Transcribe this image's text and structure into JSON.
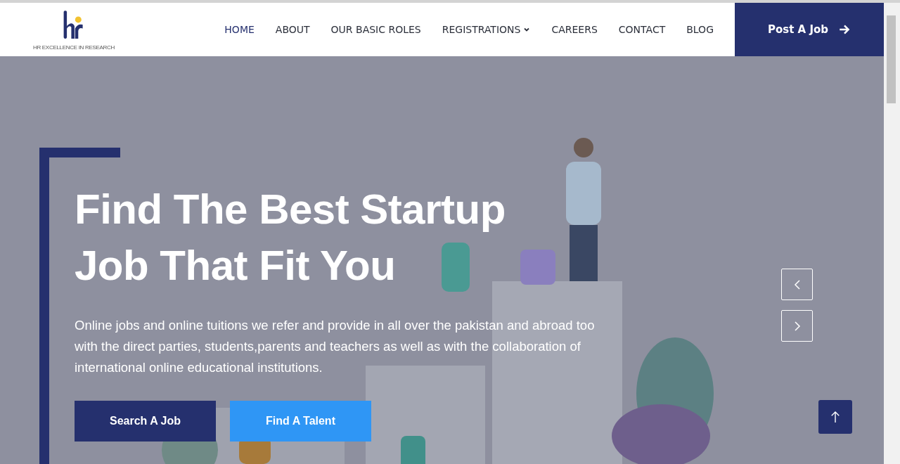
{
  "logo": {
    "caption": "HR EXCELLENCE IN RESEARCH"
  },
  "nav": [
    {
      "label": "HOME",
      "selected": true,
      "dropdown": false
    },
    {
      "label": "ABOUT",
      "selected": false,
      "dropdown": false
    },
    {
      "label": "OUR BASIC ROLES",
      "selected": false,
      "dropdown": false
    },
    {
      "label": "REGISTRATIONS",
      "selected": false,
      "dropdown": true
    },
    {
      "label": "CAREERS",
      "selected": false,
      "dropdown": false
    },
    {
      "label": "CONTACT",
      "selected": false,
      "dropdown": false
    },
    {
      "label": "BLOG",
      "selected": false,
      "dropdown": false
    }
  ],
  "cta": {
    "label": "Post A Job"
  },
  "hero": {
    "title_lines": [
      "Find The Best Startup",
      "Job That Fit You"
    ],
    "text": "Online jobs and online tuitions we refer and provide in all over the pakistan and abroad too with the direct parties, students,parents and teachers as well as with the collaboration of international online educational institutions.",
    "buttons": [
      {
        "label": "Search A Job",
        "kind": "primary"
      },
      {
        "label": "Find A Talent",
        "kind": "secondary"
      }
    ]
  }
}
